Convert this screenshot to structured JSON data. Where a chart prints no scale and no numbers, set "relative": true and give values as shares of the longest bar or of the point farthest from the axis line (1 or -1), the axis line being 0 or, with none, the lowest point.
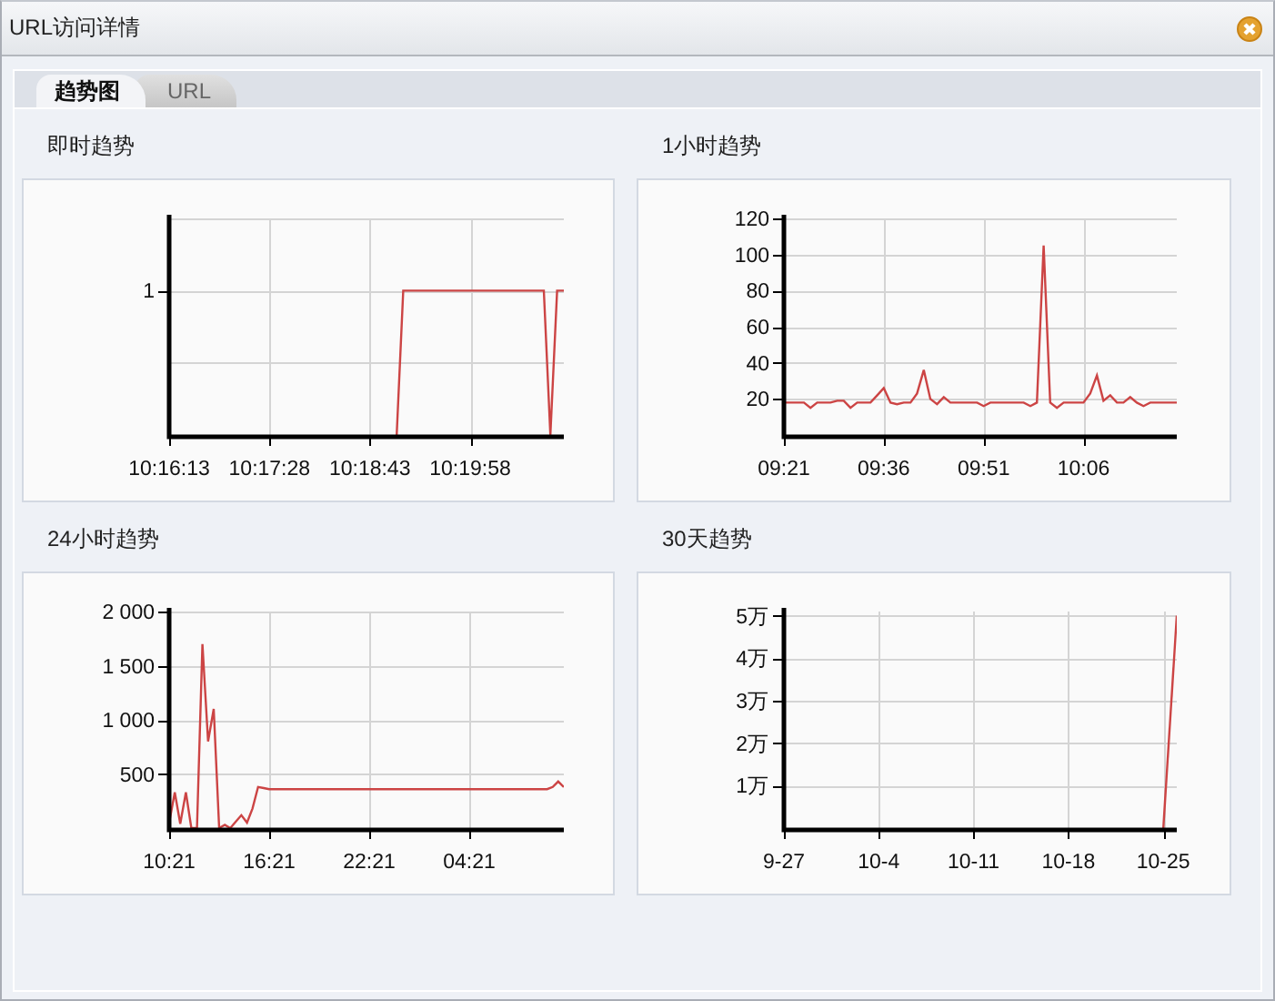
{
  "window": {
    "title": "URL访问详情"
  },
  "tabs": [
    {
      "label": "趋势图",
      "selected": true
    },
    {
      "label": "URL",
      "selected": false
    }
  ],
  "panels": [
    {
      "title": "即时趋势",
      "chart_data": {
        "type": "line",
        "relative": true,
        "grid": true,
        "annotations": [
          "1"
        ],
        "categories": [
          "10:16:13",
          null,
          null,
          null,
          null,
          null,
          null,
          null,
          null,
          null,
          null,
          null,
          null,
          null,
          null,
          "10:17:28",
          null,
          null,
          null,
          null,
          null,
          null,
          null,
          null,
          null,
          null,
          null,
          null,
          null,
          null,
          "10:18:43",
          null,
          null,
          null,
          null,
          null,
          null,
          null,
          null,
          null,
          null,
          null,
          null,
          null,
          null,
          "10:19:58",
          null,
          null,
          null,
          null,
          null,
          null,
          null,
          null,
          null,
          null,
          null,
          null,
          null,
          null
        ],
        "series": [
          {
            "color": "#cc4444",
            "values": [
              null,
              null,
              null,
              null,
              null,
              null,
              null,
              null,
              null,
              null,
              null,
              null,
              null,
              null,
              null,
              null,
              null,
              null,
              null,
              null,
              null,
              null,
              null,
              null,
              null,
              null,
              null,
              null,
              null,
              null,
              null,
              null,
              null,
              null,
              0,
              1,
              1,
              1,
              1,
              1,
              1,
              1,
              1,
              1,
              1,
              1,
              1,
              1,
              1,
              1,
              1,
              1,
              1,
              1,
              1,
              1,
              1,
              0,
              1,
              1
            ]
          }
        ]
      }
    },
    {
      "title": "1小时趋势",
      "chart_data": {
        "type": "line",
        "grid": true,
        "ylim": [
          0,
          120
        ],
        "yticks": [
          20,
          40,
          60,
          80,
          100,
          120
        ],
        "categories": [
          "09:21",
          null,
          null,
          null,
          null,
          null,
          null,
          null,
          null,
          null,
          null,
          null,
          null,
          null,
          null,
          "09:36",
          null,
          null,
          null,
          null,
          null,
          null,
          null,
          null,
          null,
          null,
          null,
          null,
          null,
          null,
          "09:51",
          null,
          null,
          null,
          null,
          null,
          null,
          null,
          null,
          null,
          null,
          null,
          null,
          null,
          null,
          "10:06",
          null,
          null,
          null,
          null,
          null,
          null,
          null,
          null,
          null,
          null,
          null,
          null,
          null,
          null
        ],
        "series": [
          {
            "color": "#cc4444",
            "values": [
              18,
              18,
              18,
              18,
              15,
              18,
              18,
              18,
              19,
              19,
              15,
              18,
              18,
              18,
              22,
              26,
              18,
              17,
              18,
              18,
              23,
              36,
              20,
              17,
              21,
              18,
              18,
              18,
              18,
              18,
              16,
              18,
              18,
              18,
              18,
              18,
              18,
              16,
              18,
              105,
              18,
              15,
              18,
              18,
              18,
              18,
              23,
              33,
              19,
              22,
              18,
              18,
              21,
              18,
              16,
              18,
              18,
              18,
              18,
              18
            ]
          }
        ]
      }
    },
    {
      "title": "24小时趋势",
      "chart_data": {
        "type": "line",
        "grid": true,
        "ylim": [
          0,
          2000
        ],
        "yticks": [
          {
            "value": 500,
            "label": "500"
          },
          {
            "value": 1000,
            "label": "1 000"
          },
          {
            "value": 1500,
            "label": "1 500"
          },
          {
            "value": 2000,
            "label": "2 000"
          }
        ],
        "categories": [
          "10:21",
          null,
          null,
          null,
          null,
          null,
          null,
          null,
          null,
          null,
          null,
          null,
          null,
          null,
          null,
          null,
          null,
          null,
          "16:21",
          null,
          null,
          null,
          null,
          null,
          null,
          null,
          null,
          null,
          null,
          null,
          null,
          null,
          null,
          null,
          null,
          null,
          "22:21",
          null,
          null,
          null,
          null,
          null,
          null,
          null,
          null,
          null,
          null,
          null,
          null,
          null,
          null,
          null,
          null,
          null,
          "04:21",
          null,
          null,
          null,
          null,
          null,
          null,
          null,
          null,
          null,
          null,
          null,
          null,
          null,
          null,
          null,
          null,
          null
        ],
        "series": [
          {
            "color": "#cc4444",
            "values": [
              50,
              330,
              40,
              330,
              0,
              0,
              1700,
              800,
              1100,
              0,
              30,
              0,
              60,
              120,
              50,
              180,
              380,
              370,
              360,
              360,
              360,
              360,
              360,
              360,
              360,
              360,
              360,
              360,
              360,
              360,
              360,
              360,
              360,
              360,
              360,
              360,
              360,
              360,
              360,
              360,
              360,
              360,
              360,
              360,
              360,
              360,
              360,
              360,
              360,
              360,
              360,
              360,
              360,
              360,
              360,
              360,
              360,
              360,
              360,
              360,
              360,
              360,
              360,
              360,
              360,
              360,
              360,
              360,
              360,
              380,
              430,
              380
            ]
          }
        ]
      }
    },
    {
      "title": "30天趋势",
      "chart_data": {
        "type": "line",
        "relative": true,
        "grid": true,
        "annotations": [
          "1万",
          "2万",
          "3万",
          "4万",
          "5万"
        ],
        "categories": [
          "9-27",
          null,
          null,
          null,
          null,
          null,
          null,
          "10-4",
          null,
          null,
          null,
          null,
          null,
          null,
          "10-11",
          null,
          null,
          null,
          null,
          null,
          null,
          "10-18",
          null,
          null,
          null,
          null,
          null,
          null,
          "10-25",
          null
        ],
        "series": [
          {
            "color": "#cc4444",
            "values": [
              null,
              null,
              null,
              null,
              null,
              null,
              null,
              null,
              null,
              null,
              null,
              null,
              null,
              null,
              null,
              null,
              null,
              null,
              null,
              null,
              null,
              null,
              null,
              null,
              null,
              null,
              null,
              null,
              0,
              1
            ]
          }
        ]
      }
    }
  ]
}
